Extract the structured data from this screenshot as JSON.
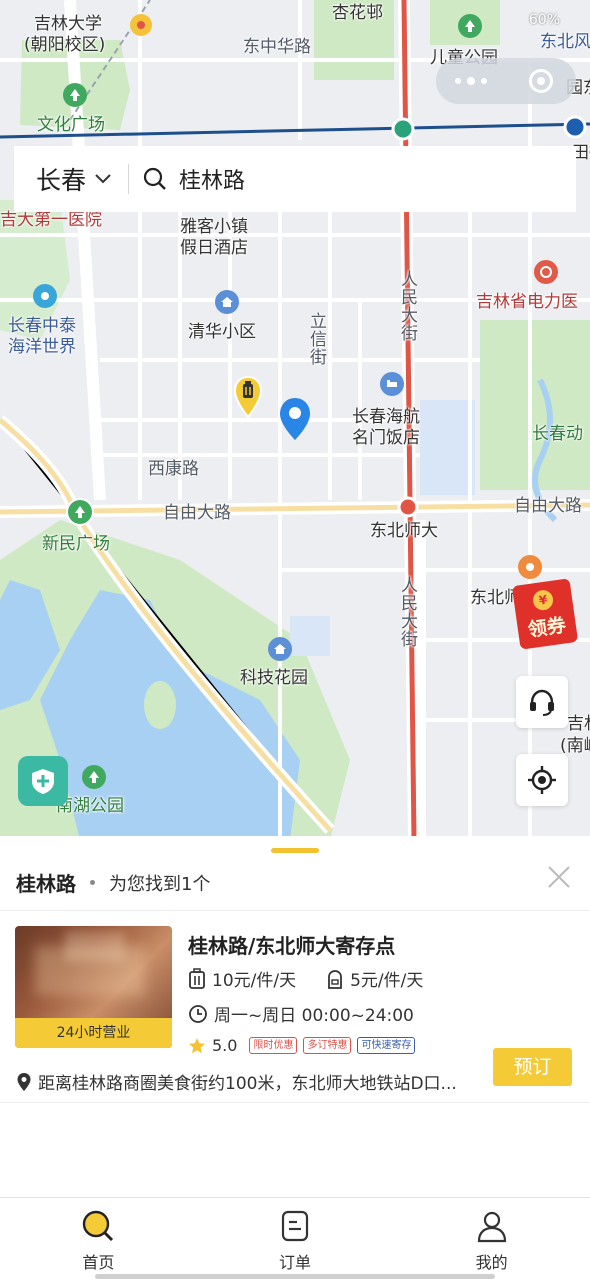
{
  "status_bar": {
    "battery": "60%"
  },
  "map": {
    "labels": {
      "jilin_univ": "吉林大学",
      "jilin_univ_campus": "(朝阳校区)",
      "xinghua": "杏花邨",
      "dongzhonghua": "东中华路",
      "children_park": "儿童公园",
      "dongbei_edge": "东北风",
      "yuan_edge": "园东",
      "wenhua": "文化广场",
      "tian_edge": "田街",
      "first_hospital": "吉大第一医院",
      "yake": "雅客小镇",
      "yake2": "假日酒店",
      "power_company": "吉林省电力医",
      "zhongtai": "长春中泰",
      "ocean": "海洋世界",
      "qinghua": "清华小区",
      "lixin": "立信街",
      "renmin1": "人民大街",
      "haihang": "长春海航",
      "mingmen": "名门饭店",
      "changchun_zoo": "长春动",
      "xikang": "西康路",
      "ziyou_west": "自由大路",
      "ziyou_east": "自由大路",
      "xinmin": "新民广场",
      "dongbei_shida_station": "东北师大",
      "dongbei_shida_univ": "东北师大学",
      "renmin2": "人民大街",
      "keji": "科技花园",
      "jilin_nanling": "吉林",
      "jilin_nanling2": "(南岭",
      "nanhu": "南湖公园"
    },
    "coupon_label": "领券"
  },
  "search": {
    "city": "长春",
    "query": "桂林路"
  },
  "sheet": {
    "keyword": "桂林路",
    "result_count_text": "为您找到1个",
    "result": {
      "name": "桂林路/东北师大寄存点",
      "badge": "24小时营业",
      "price_large": "10元/件/天",
      "price_small": "5元/件/天",
      "hours": "周一~周日 00:00~24:00",
      "rating": "5.0",
      "tags": [
        "限时优惠",
        "多订特惠",
        "可快速寄存"
      ],
      "address": "距离桂林路商圈美食街约100米，东北师大地铁站D口...",
      "book_label": "预订"
    }
  },
  "tabs": [
    {
      "label": "首页",
      "icon": "search-icon"
    },
    {
      "label": "订单",
      "icon": "order-icon"
    },
    {
      "label": "我的",
      "icon": "user-icon"
    }
  ],
  "colors": {
    "accent": "#F4CB36",
    "road_red": "#E05545",
    "metro_blue": "#1D4F8C",
    "park_green": "#CFE9C4",
    "water_blue": "#A8D0F2"
  }
}
